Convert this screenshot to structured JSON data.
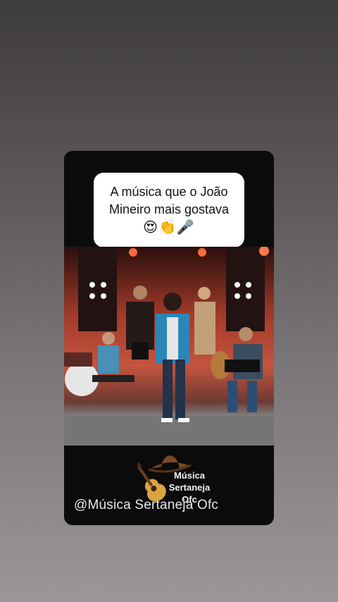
{
  "post": {
    "caption_line1": "A música que o João",
    "caption_line2": "Mineiro mais gostava",
    "caption_emojis": "😍👏🎤"
  },
  "watermark": {
    "line1": "Música",
    "line2": "Sertaneja",
    "line3": "Ofc",
    "handle": "@Música Sertaneja Ofc"
  }
}
